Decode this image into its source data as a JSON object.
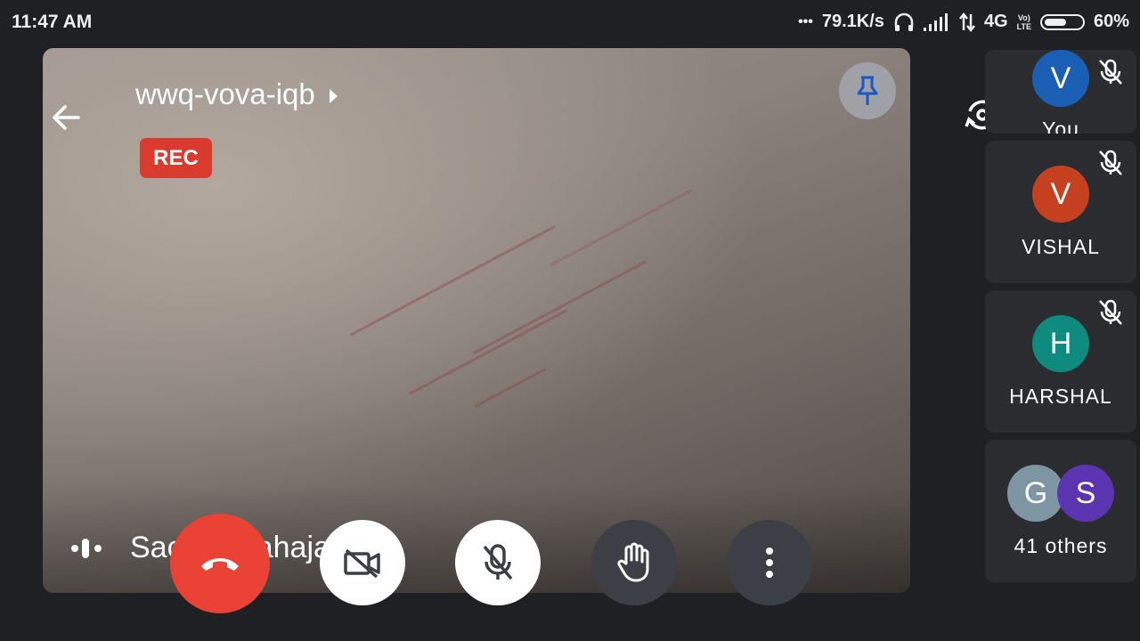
{
  "status_bar": {
    "time": "11:47 AM",
    "dots": "•••",
    "speed": "79.1K/s",
    "network": "4G",
    "lte_top": "Vo)",
    "lte_bottom": "LTE",
    "battery": "60%",
    "battery_level": 0.6
  },
  "meeting": {
    "code": "wwq-vova-iqb",
    "rec_label": "REC",
    "active_speaker": "Sachin Mahajan"
  },
  "participants": [
    {
      "initial": "V",
      "name": "You",
      "color": "#1a5fb4",
      "muted": true
    },
    {
      "initial": "V",
      "name": "VISHAL",
      "color": "#c4401f",
      "muted": true
    },
    {
      "initial": "H",
      "name": "HARSHAL",
      "color": "#0f8a7e",
      "muted": true
    }
  ],
  "others": {
    "avatars": [
      {
        "initial": "G",
        "color": "#7e96a4"
      },
      {
        "initial": "S",
        "color": "#5b35b0"
      }
    ],
    "label": "41 others"
  },
  "colors": {
    "end_call": "#ea4335",
    "rec": "#d93c2e"
  },
  "icons": [
    "back-arrow-icon",
    "pin-icon",
    "switch-camera-icon",
    "audio-output-icon",
    "end-call-icon",
    "camera-off-icon",
    "mic-off-icon",
    "raise-hand-icon",
    "more-options-icon",
    "voice-activity-icon"
  ]
}
